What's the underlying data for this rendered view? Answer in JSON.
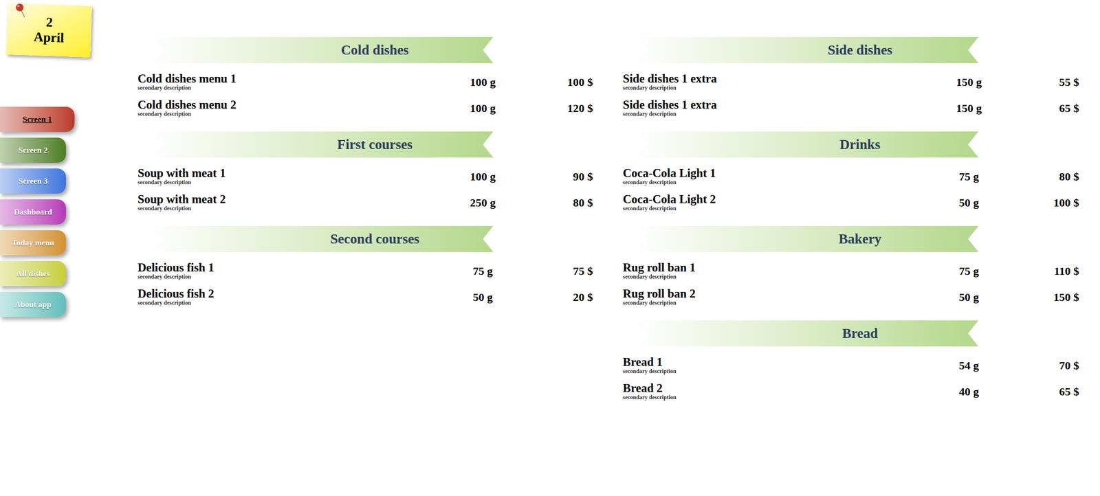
{
  "date": {
    "day": "2",
    "month": "April"
  },
  "sidebar": {
    "items": [
      {
        "label": "Screen 1",
        "selected": true,
        "color": "#b83a2a"
      },
      {
        "label": "Screen 2",
        "selected": false,
        "color": "#4d7d1f"
      },
      {
        "label": "Screen 3",
        "selected": false,
        "color": "#3f74dc"
      },
      {
        "label": "Dashboard",
        "selected": false,
        "color": "#b637b8"
      },
      {
        "label": "Today menu",
        "selected": false,
        "color": "#d3922a"
      },
      {
        "label": "All dishes",
        "selected": false,
        "color": "#c7cf33"
      },
      {
        "label": "About app",
        "selected": false,
        "color": "#5fbfbc"
      }
    ]
  },
  "columns": [
    [
      {
        "title": "Cold dishes",
        "items": [
          {
            "name": "Cold dishes menu 1",
            "description": "secondary description",
            "weight": "100 g",
            "price": "100 $"
          },
          {
            "name": "Cold dishes menu 2",
            "description": "secondary description",
            "weight": "100 g",
            "price": "120 $"
          }
        ]
      },
      {
        "title": "First courses",
        "items": [
          {
            "name": "Soup with meat 1",
            "description": "secondary description",
            "weight": "100 g",
            "price": "90 $"
          },
          {
            "name": "Soup with meat 2",
            "description": "secondary description",
            "weight": "250 g",
            "price": "80 $"
          }
        ]
      },
      {
        "title": "Second courses",
        "items": [
          {
            "name": "Delicious fish 1",
            "description": "secondary description",
            "weight": "75 g",
            "price": "75 $"
          },
          {
            "name": "Delicious fish 2",
            "description": "secondary description",
            "weight": "50 g",
            "price": "20 $"
          }
        ]
      }
    ],
    [
      {
        "title": "Side dishes",
        "items": [
          {
            "name": "Side dishes 1 extra",
            "description": "secondary description",
            "weight": "150 g",
            "price": "55 $"
          },
          {
            "name": "Side dishes 1 extra",
            "description": "secondary description",
            "weight": "150 g",
            "price": "65 $"
          }
        ]
      },
      {
        "title": "Drinks",
        "items": [
          {
            "name": "Coca-Cola Light 1",
            "description": "secondary description",
            "weight": "75 g",
            "price": "80 $"
          },
          {
            "name": "Coca-Cola Light 2",
            "description": "secondary description",
            "weight": "50 g",
            "price": "100 $"
          }
        ]
      },
      {
        "title": "Bakery",
        "items": [
          {
            "name": "Rug roll ban 1",
            "description": "secondary description",
            "weight": "75 g",
            "price": "110 $"
          },
          {
            "name": "Rug roll ban 2",
            "description": "secondary description",
            "weight": "50 g",
            "price": "150 $"
          }
        ]
      },
      {
        "title": "Bread",
        "items": [
          {
            "name": "Bread 1",
            "description": "secondary description",
            "weight": "54 g",
            "price": "70 $"
          },
          {
            "name": "Bread 2",
            "description": "secondary description",
            "weight": "40 g",
            "price": "65 $"
          }
        ]
      }
    ]
  ]
}
